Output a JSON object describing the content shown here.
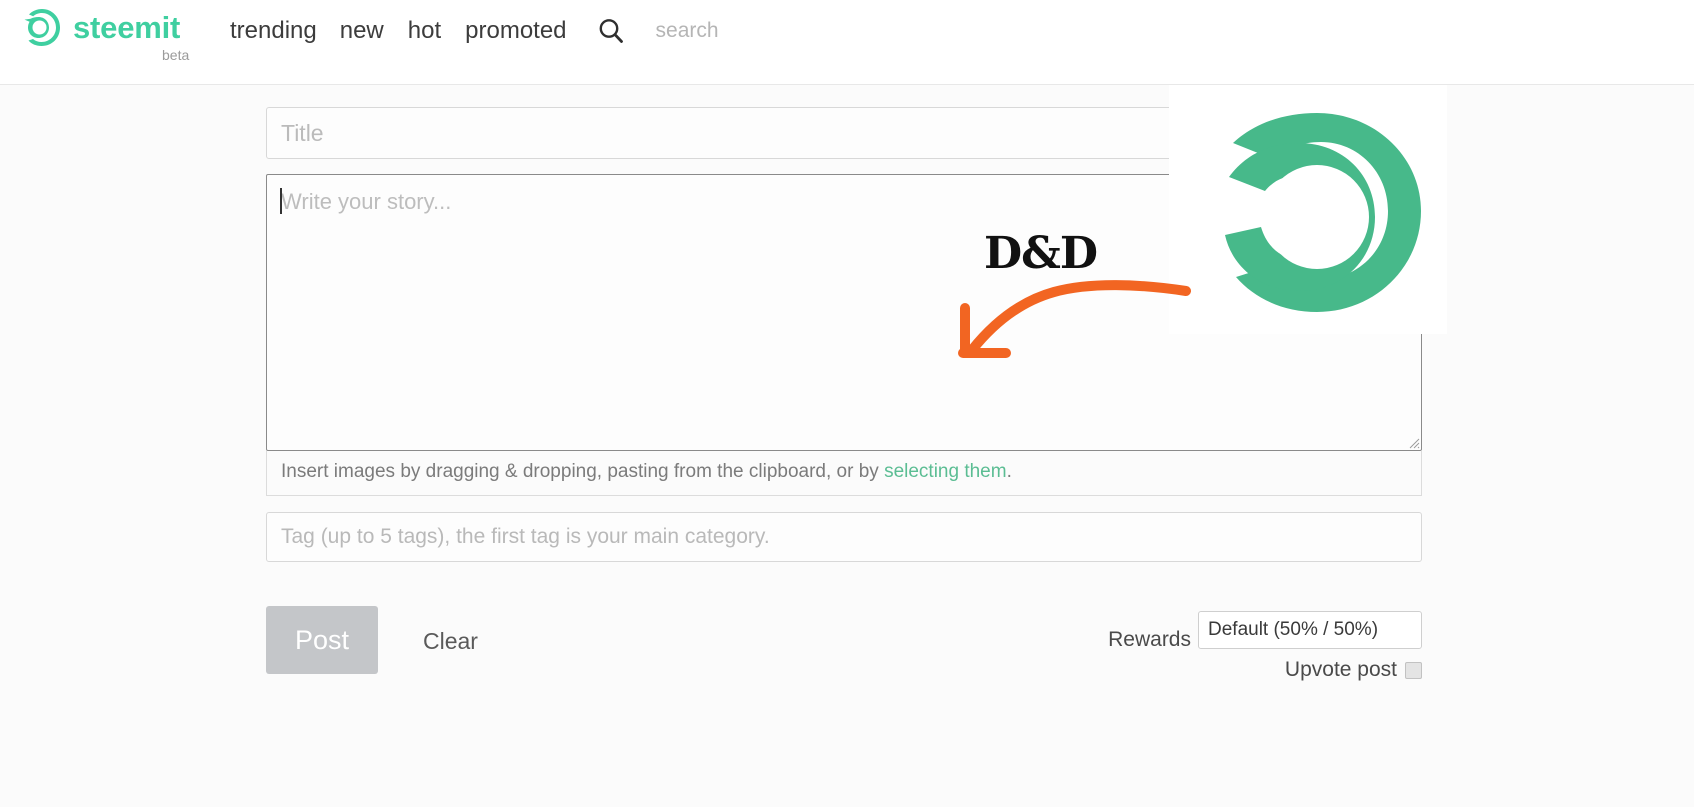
{
  "header": {
    "brand_name": "steemit",
    "beta_label": "beta",
    "brand_color": "#3fcfa0",
    "nav_items": [
      {
        "label": "trending"
      },
      {
        "label": "new"
      },
      {
        "label": "hot"
      },
      {
        "label": "promoted"
      }
    ],
    "search": {
      "icon": "search-icon",
      "placeholder": "search",
      "value": ""
    }
  },
  "editor": {
    "title_field": {
      "placeholder": "Title",
      "value": ""
    },
    "story_field": {
      "placeholder": "Write your story...",
      "value": "",
      "focused": true
    },
    "help_text": {
      "prefix": "Insert images by dragging & dropping, pasting from the clipboard, or by ",
      "link_label": "selecting them",
      "suffix": ".",
      "link_color": "#5bbd93"
    },
    "tag_field": {
      "placeholder": "Tag (up to 5 tags), the first tag is your main category.",
      "value": ""
    }
  },
  "footer": {
    "post_label": "Post",
    "clear_label": "Clear",
    "rewards_label": "Rewards",
    "rewards_selected": "Default (50% / 50%)",
    "upvote_label": "Upvote post",
    "upvote_checked": false
  },
  "annotation": {
    "text": "D&D",
    "arrow_color": "#F26522",
    "text_color": "#111111"
  },
  "watermark": {
    "icon": "steemit-logo-icon",
    "color": "#47b98a"
  }
}
